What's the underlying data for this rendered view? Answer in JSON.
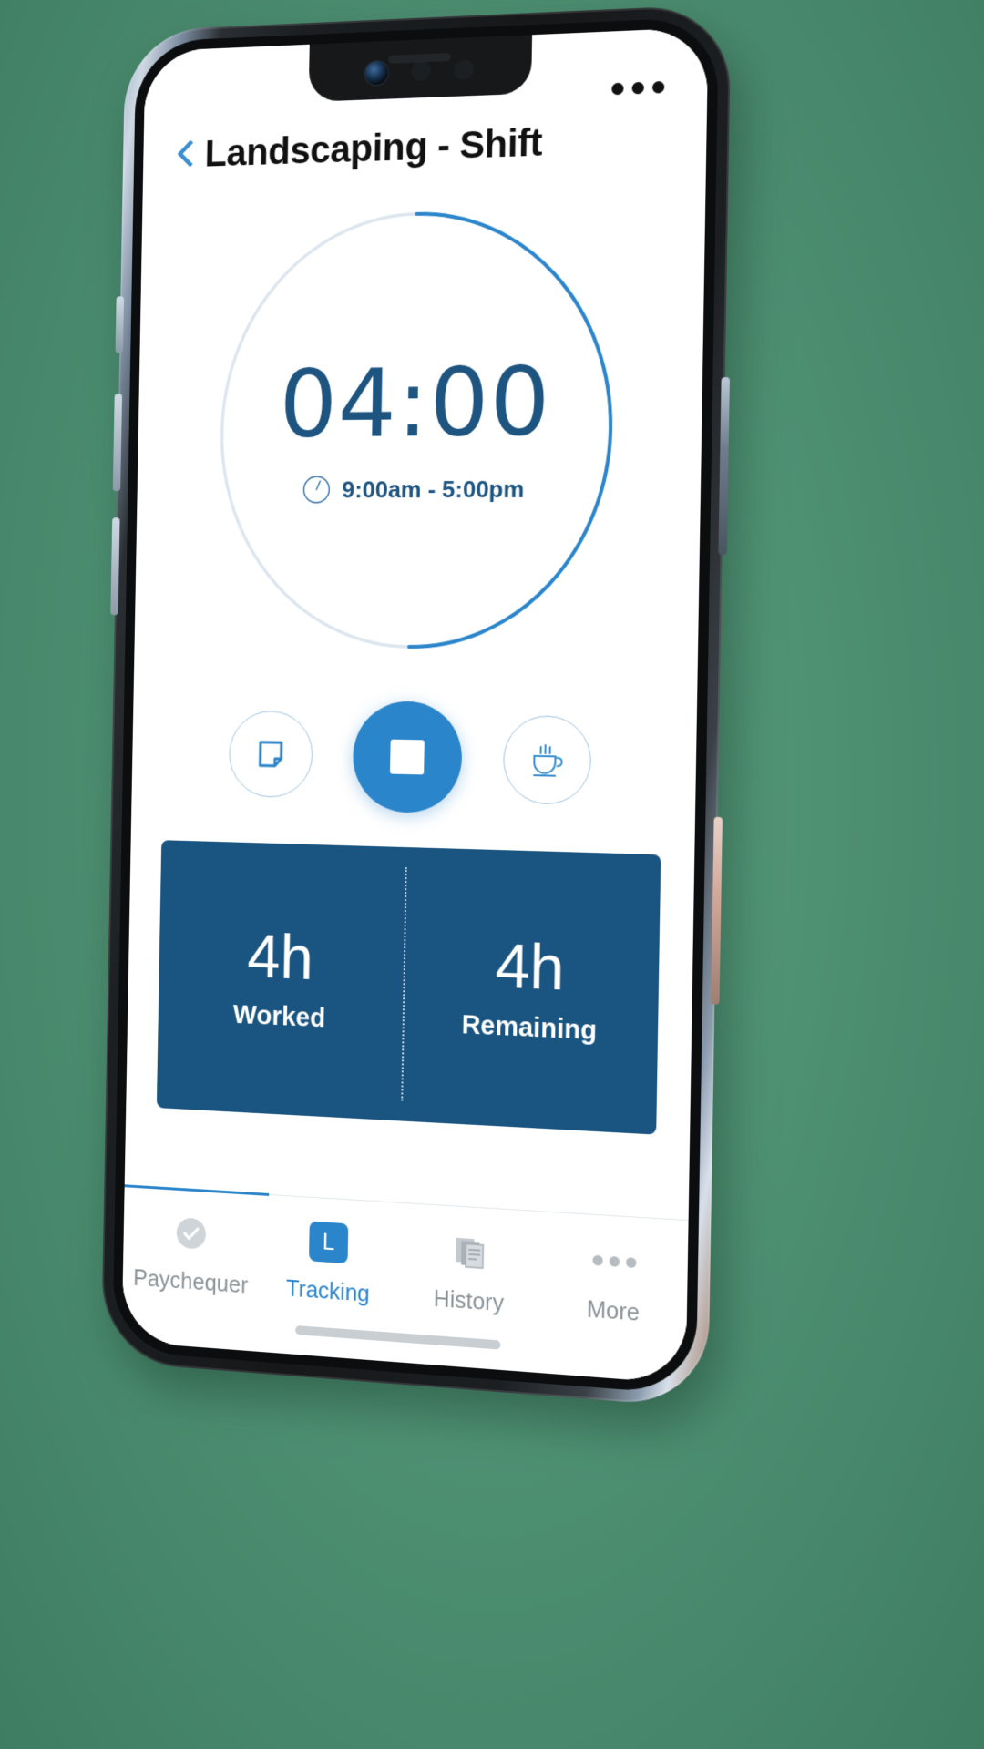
{
  "app": {
    "header": {
      "title": "Landscaping - Shift",
      "back_icon": "chevron-left-icon",
      "overflow_icon": "more-horizontal-icon"
    },
    "timer": {
      "value": "04:00",
      "schedule": "9:00am - 5:00pm",
      "schedule_icon": "clock-icon",
      "progress_percent": 50,
      "track_color": "#dde6ef",
      "progress_color": "#2b85cb",
      "value_color": "#1d5480"
    },
    "controls": [
      {
        "name": "note-button",
        "icon": "note-icon",
        "style": "outline"
      },
      {
        "name": "stop-button",
        "icon": "stop-icon",
        "style": "primary"
      },
      {
        "name": "break-button",
        "icon": "coffee-cup-icon",
        "style": "outline"
      }
    ],
    "stats": {
      "panel_color": "#1a5480",
      "items": [
        {
          "value": "4h",
          "label": "Worked"
        },
        {
          "value": "4h",
          "label": "Remaining"
        }
      ]
    },
    "tabs": [
      {
        "label": "Paychequer",
        "icon": "check-circle-icon",
        "active": false
      },
      {
        "label": "Tracking",
        "icon": "l-square-icon",
        "active": true
      },
      {
        "label": "History",
        "icon": "documents-icon",
        "active": false
      },
      {
        "label": "More",
        "icon": "more-dots-icon",
        "active": false
      }
    ],
    "accent_color": "#2b85cb"
  }
}
